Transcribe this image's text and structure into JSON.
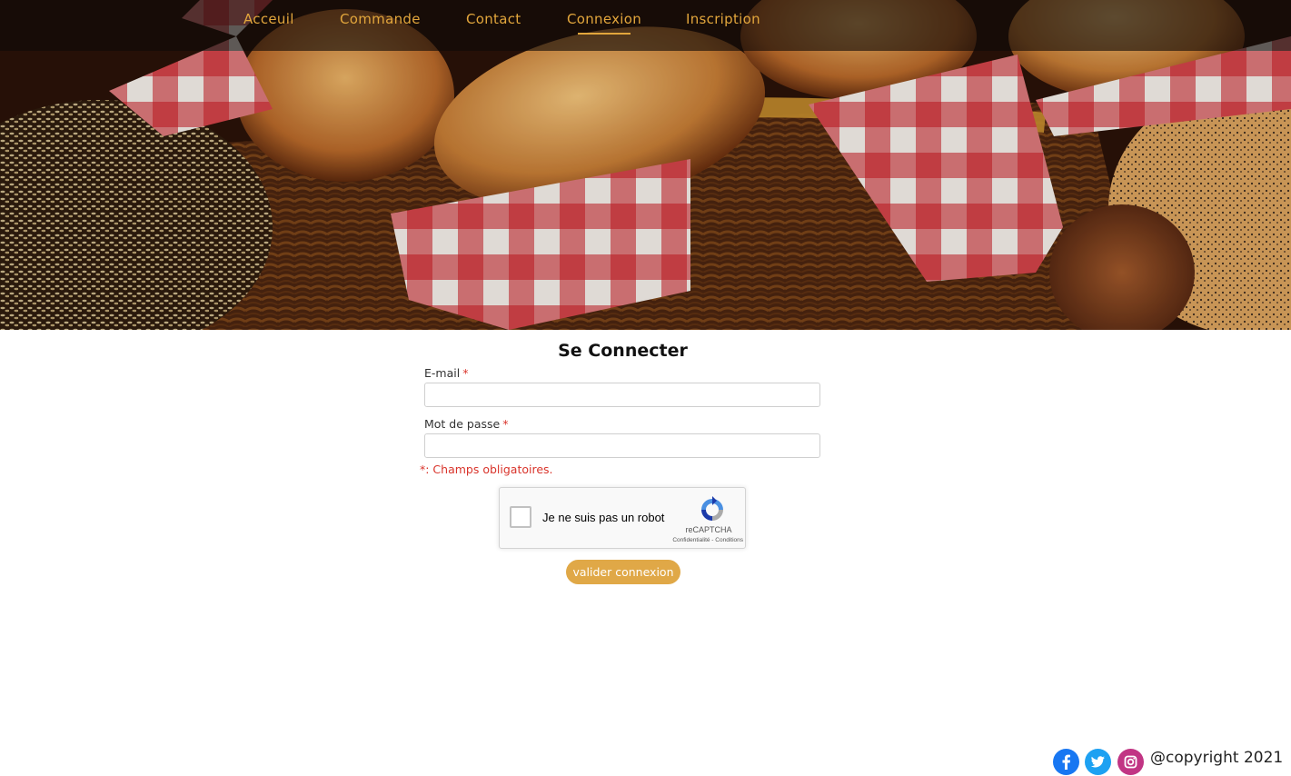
{
  "nav": {
    "items": [
      {
        "label": "Acceuil"
      },
      {
        "label": "Commande"
      },
      {
        "label": "Contact"
      },
      {
        "label": "Connexion",
        "active": true
      },
      {
        "label": "Inscription"
      }
    ]
  },
  "form": {
    "title": "Se Connecter",
    "email_label": "E-mail",
    "email_value": "",
    "password_label": "Mot de passe",
    "password_value": "",
    "required_marker": "*",
    "required_note": "*: Champs obligatoires.",
    "submit_label": "valider connexion"
  },
  "recaptcha": {
    "label": "Je ne suis pas un robot",
    "brand": "reCAPTCHA",
    "terms": "Confidentialité - Conditions"
  },
  "footer": {
    "copyright": "@copyright 2021",
    "social": [
      "facebook-icon",
      "twitter-icon",
      "instagram-icon"
    ]
  },
  "colors": {
    "accent": "#e0a847",
    "nav_text": "#e2a63c",
    "required": "#d9342b",
    "facebook": "#1877f2",
    "twitter": "#1da1f2",
    "instagram": "#c13584"
  }
}
